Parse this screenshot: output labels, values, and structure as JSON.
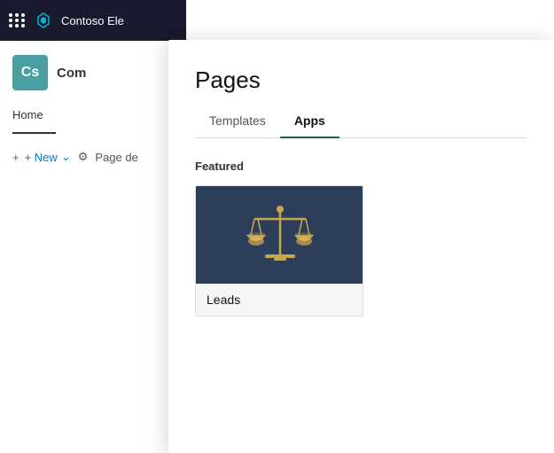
{
  "topbar": {
    "title": "Contoso Ele",
    "logo_symbol": "✦"
  },
  "sidebar": {
    "org_initials": "Cs",
    "org_name": "Com",
    "home_label": "Home",
    "toolbar_new": "+ New",
    "toolbar_chevron": "⌄",
    "toolbar_settings": "⚙",
    "toolbar_page_designer": "Page de"
  },
  "panel": {
    "title": "Pages",
    "tabs": [
      {
        "label": "Templates",
        "active": false
      },
      {
        "label": "Apps",
        "active": true
      }
    ],
    "featured_label": "Featured",
    "apps": [
      {
        "name": "Leads"
      }
    ]
  }
}
